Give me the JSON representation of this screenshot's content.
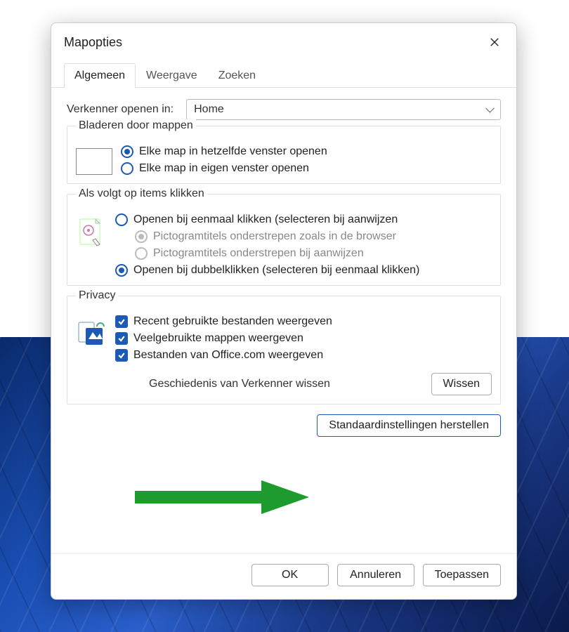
{
  "dialog": {
    "title": "Mapopties",
    "tabs": [
      "Algemeen",
      "Weergave",
      "Zoeken"
    ],
    "active_tab": 0
  },
  "open_in": {
    "label": "Verkenner openen in:",
    "value": "Home"
  },
  "browse": {
    "legend": "Bladeren door mappen",
    "options": [
      "Elke map in hetzelfde venster openen",
      "Elke map in eigen venster openen"
    ],
    "selected": 0
  },
  "click_items": {
    "legend": "Als volgt op items klikken",
    "opt_single": "Openen bij eenmaal klikken (selecteren bij aanwijzen",
    "opt_single_sub1": "Pictogramtitels onderstrepen zoals in de browser",
    "opt_single_sub2": "Pictogramtitels onderstrepen bij aanwijzen",
    "opt_double": "Openen bij dubbelklikken (selecteren bij eenmaal klikken)",
    "selected": "double"
  },
  "privacy": {
    "legend": "Privacy",
    "checks": [
      "Recent gebruikte bestanden weergeven",
      "Veelgebruikte mappen weergeven",
      "Bestanden van Office.com weergeven"
    ],
    "history_label": "Geschiedenis van Verkenner wissen",
    "clear_btn": "Wissen"
  },
  "restore_btn": "Standaardinstellingen herstellen",
  "footer": {
    "ok": "OK",
    "cancel": "Annuleren",
    "apply": "Toepassen"
  }
}
